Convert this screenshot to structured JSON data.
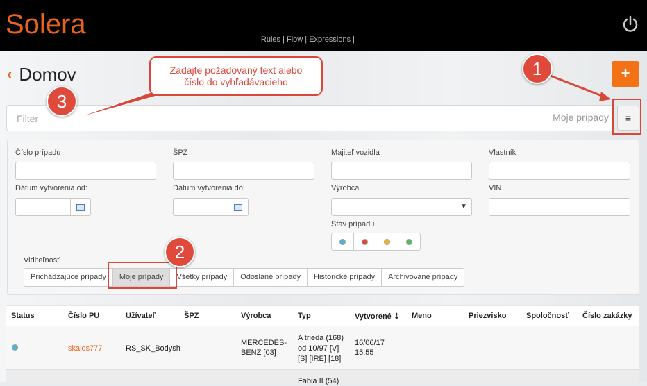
{
  "header": {
    "logo_text": "Solera",
    "nav_text": "| Rules | Flow | Expressions |",
    "power_icon": "power-icon"
  },
  "page": {
    "back_icon": "chevron-left-icon",
    "title": "Domov",
    "add_label": "+"
  },
  "filter": {
    "placeholder": "Filter",
    "tag": "Moje prípady",
    "menu_icon": "≡"
  },
  "search_form": {
    "case_number_label": "Číslo prípadu",
    "plate_label": "ŠPZ",
    "owner_vehicle_label": "Majiteľ vozidla",
    "owner_label": "Vlastník",
    "created_from_label": "Dátum vytvorenia od:",
    "created_to_label": "Dátum vytvorenia do:",
    "maker_label": "Výrobca",
    "vin_label": "VIN",
    "state_label": "Stav prípadu",
    "visibility_label": "Viditeľnosť",
    "visibility_options": [
      "Prichádzajúce prípady",
      "Moje prípady",
      "Všetky prípady",
      "Odoslané prípady",
      "Historické prípady",
      "Archivované prípady"
    ],
    "visibility_selected": "Moje prípady"
  },
  "table": {
    "columns": [
      "Status",
      "Číslo PU",
      "Užívateľ",
      "ŠPZ",
      "Výrobca",
      "Typ",
      "Vytvorené ⇣",
      "Meno",
      "Priezvisko",
      "Spoločnosť",
      "Číslo zakázky"
    ],
    "rows": [
      {
        "case_number": "skalos777",
        "user": "RS_SK_Bodysh",
        "maker_line1": "MERCEDES-",
        "maker_line2": "BENZ [03]",
        "type_line1": "A trieda (168)",
        "type_line2": "od 10/97 [V]",
        "type_line3": "[S] [IRE] [18]",
        "created_date": "16/06/17",
        "created_time": "15:55"
      },
      {
        "type_line1": "Fabia II (54)"
      }
    ]
  },
  "annotations": {
    "step1": "1",
    "step2": "2",
    "step3": "3",
    "callout_line1": "Zadajte požadovaný text alebo",
    "callout_line2": "číslo do vyhľadávacieho"
  },
  "colors": {
    "accent": "#f47216",
    "annotation_red": "#d9463a",
    "topbar": "#000000"
  }
}
